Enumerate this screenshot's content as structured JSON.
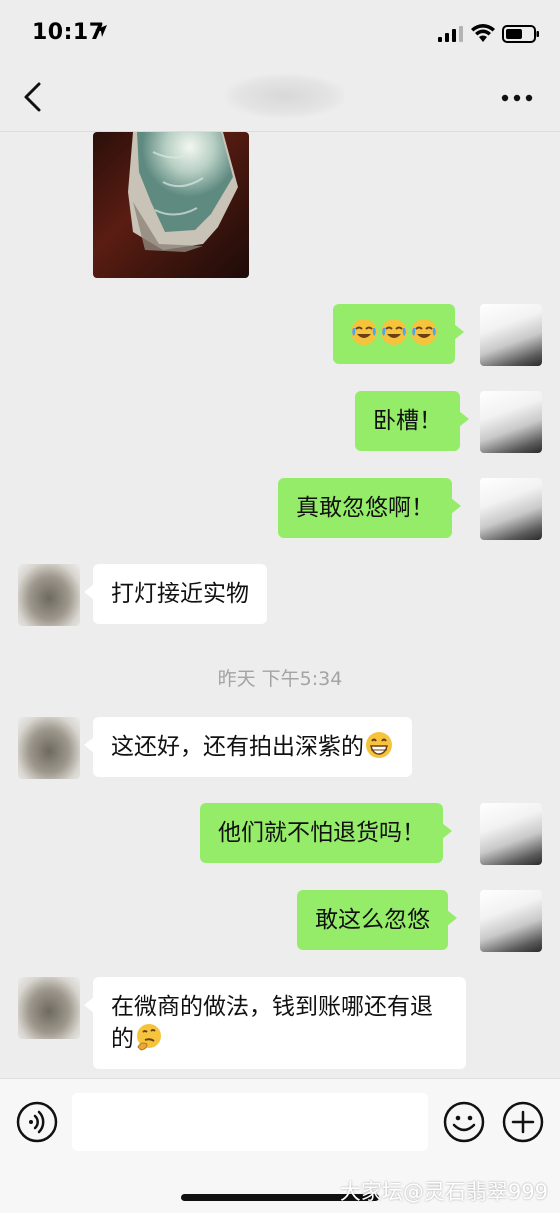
{
  "status_bar": {
    "time": "10:17"
  },
  "chat": {
    "messages": [
      {
        "side": "me",
        "text": "",
        "emojis": [
          "face-with-tears-of-joy",
          "face-with-tears-of-joy",
          "face-with-tears-of-joy"
        ]
      },
      {
        "side": "me",
        "text": "卧槽！"
      },
      {
        "side": "me",
        "text": "真敢忽悠啊！"
      },
      {
        "side": "other",
        "text": "打灯接近实物"
      },
      {
        "side": "other",
        "text": "这还好，还有拍出深紫的"
      },
      {
        "side": "me",
        "text": "他们就不怕退货吗！"
      },
      {
        "side": "me",
        "text": "敢这么忽悠"
      },
      {
        "side": "other",
        "text": "在微商的做法，钱到账哪还有退的"
      }
    ],
    "timestamp": "昨天 下午5:34"
  },
  "watermark": "大家坛@灵石翡翠999",
  "icons": {
    "back": "back-chevron-icon",
    "more": "more-dots-icon",
    "voice": "voice-icon",
    "emoji": "smiley-icon",
    "plus": "plus-icon"
  },
  "colors": {
    "my_bubble": "#95ec69",
    "other_bubble": "#ffffff",
    "background": "#ededed"
  }
}
